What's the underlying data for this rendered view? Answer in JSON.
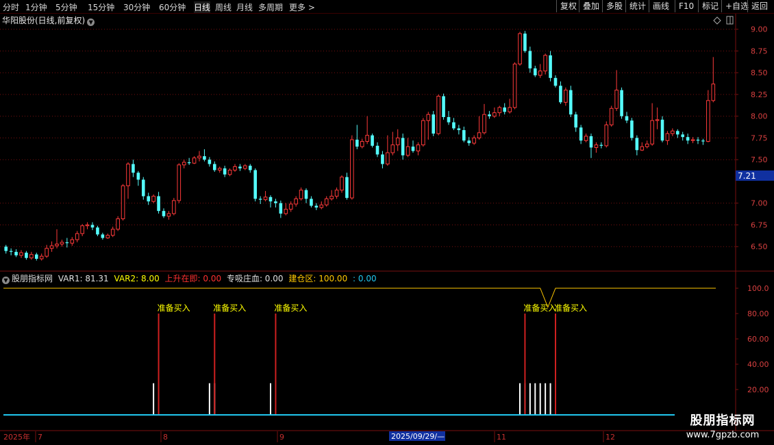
{
  "toolbar": {
    "periods": [
      "分时",
      "1分钟",
      "5分钟",
      "15分钟",
      "30分钟",
      "60分钟",
      "日线",
      "周线",
      "月线",
      "多周期",
      "更多 >"
    ],
    "active_period": "日线",
    "right_buttons": [
      "复权",
      "叠加",
      "多股",
      "统计",
      "画线",
      "F10",
      "标记",
      "+自选",
      "返回"
    ]
  },
  "stock_title": "华阳股份(日线,前复权)",
  "indicator": {
    "name": "股朋指标网",
    "var1": "VAR1: 81.31",
    "var2": "VAR2: 8.00",
    "rise": "上升在即: 0.00",
    "absorb": "专吸庄血: 0.00",
    "build": "建仓区: 100.00",
    "extra": ": 0.00"
  },
  "price_label": "7.21",
  "date_axis": {
    "year": "2025年",
    "months": [
      "7",
      "8",
      "9",
      "11",
      "12"
    ],
    "cursor_date": "2025/09/29/—"
  },
  "brand": {
    "name": "股朋指标网",
    "url": "www.7gpzb.com"
  },
  "colors": {
    "up": "#ff3a3a",
    "down": "#54fcfc",
    "ma_line": "#ffc800",
    "cyan_line": "#21c8f0",
    "grid": "#7a1010",
    "text_yellow": "#ffff00"
  },
  "chart_data": [
    {
      "type": "candlestick",
      "title": "华阳股份(日线,前复权)",
      "ylim": [
        6.25,
        9.1
      ],
      "yticks": [
        "9.00",
        "8.75",
        "8.50",
        "8.25",
        "8.00",
        "7.75",
        "7.50",
        "7.00",
        "6.75",
        "6.50"
      ],
      "ytick_values": [
        9.0,
        8.75,
        8.5,
        8.25,
        8.0,
        7.75,
        7.5,
        7.0,
        6.75,
        6.5
      ],
      "current_price": 7.21,
      "candles": [
        [
          6.5,
          6.45,
          6.52,
          6.42
        ],
        [
          6.45,
          6.44,
          6.48,
          6.4
        ],
        [
          6.44,
          6.4,
          6.47,
          6.38
        ],
        [
          6.4,
          6.43,
          6.46,
          6.37
        ],
        [
          6.43,
          6.37,
          6.45,
          6.35
        ],
        [
          6.37,
          6.41,
          6.44,
          6.35
        ],
        [
          6.41,
          6.36,
          6.43,
          6.34
        ],
        [
          6.36,
          6.39,
          6.42,
          6.34
        ],
        [
          6.39,
          6.48,
          6.52,
          6.37
        ],
        [
          6.48,
          6.51,
          6.56,
          6.44
        ],
        [
          6.51,
          6.53,
          6.7,
          6.48
        ],
        [
          6.53,
          6.55,
          6.58,
          6.5
        ],
        [
          6.55,
          6.54,
          6.6,
          6.49
        ],
        [
          6.54,
          6.58,
          6.61,
          6.51
        ],
        [
          6.58,
          6.65,
          6.68,
          6.55
        ],
        [
          6.65,
          6.74,
          6.76,
          6.62
        ],
        [
          6.74,
          6.75,
          6.78,
          6.7
        ],
        [
          6.75,
          6.72,
          6.78,
          6.69
        ],
        [
          6.72,
          6.64,
          6.74,
          6.62
        ],
        [
          6.64,
          6.6,
          6.66,
          6.58
        ],
        [
          6.6,
          6.63,
          6.65,
          6.59
        ],
        [
          6.63,
          6.7,
          6.73,
          6.61
        ],
        [
          6.7,
          6.82,
          6.85,
          6.68
        ],
        [
          6.82,
          7.2,
          7.22,
          6.8
        ],
        [
          7.2,
          7.45,
          7.47,
          7.05
        ],
        [
          7.45,
          7.35,
          7.5,
          7.3
        ],
        [
          7.35,
          7.27,
          7.37,
          7.2
        ],
        [
          7.27,
          7.08,
          7.3,
          7.04
        ],
        [
          7.08,
          7.02,
          7.12,
          6.98
        ],
        [
          7.02,
          7.08,
          7.1,
          7.0
        ],
        [
          7.08,
          6.91,
          7.13,
          6.88
        ],
        [
          6.91,
          6.85,
          6.94,
          6.83
        ],
        [
          6.85,
          6.88,
          6.91,
          6.81
        ],
        [
          6.88,
          7.03,
          7.06,
          6.86
        ],
        [
          7.03,
          7.44,
          7.46,
          7.0
        ],
        [
          7.44,
          7.47,
          7.5,
          7.4
        ],
        [
          7.47,
          7.46,
          7.52,
          7.44
        ],
        [
          7.46,
          7.52,
          7.54,
          7.45
        ],
        [
          7.52,
          7.54,
          7.6,
          7.48
        ],
        [
          7.54,
          7.5,
          7.62,
          7.48
        ],
        [
          7.5,
          7.45,
          7.53,
          7.42
        ],
        [
          7.45,
          7.38,
          7.48,
          7.36
        ],
        [
          7.38,
          7.4,
          7.42,
          7.35
        ],
        [
          7.4,
          7.33,
          7.43,
          7.3
        ],
        [
          7.33,
          7.38,
          7.4,
          7.31
        ],
        [
          7.38,
          7.42,
          7.45,
          7.36
        ],
        [
          7.42,
          7.4,
          7.45,
          7.37
        ],
        [
          7.4,
          7.43,
          7.45,
          7.38
        ],
        [
          7.43,
          7.38,
          7.45,
          7.35
        ],
        [
          7.38,
          7.05,
          7.4,
          7.02
        ],
        [
          7.05,
          7.04,
          7.08,
          6.99
        ],
        [
          7.04,
          7.07,
          7.14,
          7.02
        ],
        [
          7.07,
          7.02,
          7.09,
          6.95
        ],
        [
          7.02,
          7.0,
          7.05,
          6.95
        ],
        [
          7.0,
          6.88,
          7.03,
          6.83
        ],
        [
          6.88,
          6.93,
          7.0,
          6.86
        ],
        [
          6.93,
          6.99,
          7.02,
          6.9
        ],
        [
          6.99,
          7.05,
          7.08,
          6.96
        ],
        [
          7.05,
          7.15,
          7.18,
          7.03
        ],
        [
          7.15,
          7.05,
          7.17,
          7.0
        ],
        [
          7.05,
          6.97,
          7.08,
          6.95
        ],
        [
          6.97,
          6.95,
          7.0,
          6.92
        ],
        [
          6.95,
          6.98,
          7.02,
          6.93
        ],
        [
          6.98,
          7.05,
          7.08,
          6.96
        ],
        [
          7.05,
          7.08,
          7.15,
          7.03
        ],
        [
          7.08,
          7.15,
          7.18,
          7.05
        ],
        [
          7.15,
          7.3,
          7.32,
          7.12
        ],
        [
          7.3,
          7.06,
          7.35,
          7.04
        ],
        [
          7.06,
          7.73,
          7.78,
          7.04
        ],
        [
          7.73,
          7.65,
          7.9,
          7.62
        ],
        [
          7.65,
          7.71,
          7.74,
          7.63
        ],
        [
          7.71,
          7.78,
          8.0,
          7.68
        ],
        [
          7.78,
          7.66,
          7.8,
          7.64
        ],
        [
          7.66,
          7.56,
          7.7,
          7.53
        ],
        [
          7.56,
          7.45,
          7.6,
          7.4
        ],
        [
          7.45,
          7.58,
          7.78,
          7.43
        ],
        [
          7.58,
          7.67,
          7.82,
          7.55
        ],
        [
          7.67,
          7.75,
          7.85,
          7.6
        ],
        [
          7.75,
          7.55,
          7.8,
          7.5
        ],
        [
          7.55,
          7.65,
          7.75,
          7.53
        ],
        [
          7.65,
          7.6,
          7.72,
          7.58
        ],
        [
          7.6,
          7.67,
          7.7,
          7.55
        ],
        [
          7.67,
          7.95,
          7.98,
          7.65
        ],
        [
          7.95,
          8.02,
          8.05,
          7.73
        ],
        [
          8.02,
          7.8,
          8.06,
          7.77
        ],
        [
          7.8,
          8.23,
          8.25,
          7.78
        ],
        [
          8.23,
          7.99,
          8.26,
          7.96
        ],
        [
          7.99,
          7.93,
          8.06,
          7.9
        ],
        [
          7.93,
          7.86,
          7.98,
          7.84
        ],
        [
          7.86,
          7.84,
          7.9,
          7.79
        ],
        [
          7.84,
          7.72,
          7.88,
          7.7
        ],
        [
          7.72,
          7.69,
          7.76,
          7.66
        ],
        [
          7.69,
          7.75,
          7.78,
          7.67
        ],
        [
          7.75,
          7.81,
          8.0,
          7.73
        ],
        [
          7.81,
          8.02,
          8.14,
          7.79
        ],
        [
          8.02,
          8.0,
          8.06,
          7.97
        ],
        [
          8.0,
          8.04,
          8.1,
          7.98
        ],
        [
          8.04,
          8.1,
          8.12,
          8.0
        ],
        [
          8.1,
          8.05,
          8.15,
          8.02
        ],
        [
          8.05,
          8.1,
          8.2,
          8.03
        ],
        [
          8.1,
          8.6,
          8.62,
          8.08
        ],
        [
          8.6,
          8.95,
          8.97,
          8.58
        ],
        [
          8.95,
          8.75,
          8.98,
          8.73
        ],
        [
          8.75,
          8.55,
          8.8,
          8.5
        ],
        [
          8.55,
          8.47,
          8.58,
          8.45
        ],
        [
          8.47,
          8.52,
          8.6,
          8.44
        ],
        [
          8.52,
          8.7,
          8.72,
          8.48
        ],
        [
          8.7,
          8.44,
          8.75,
          8.4
        ],
        [
          8.44,
          8.35,
          8.47,
          8.33
        ],
        [
          8.35,
          8.16,
          8.4,
          8.14
        ],
        [
          8.16,
          8.3,
          8.33,
          8.12
        ],
        [
          8.3,
          8.02,
          8.35,
          7.99
        ],
        [
          8.02,
          7.87,
          8.05,
          7.82
        ],
        [
          7.87,
          7.72,
          7.9,
          7.68
        ],
        [
          7.72,
          7.77,
          7.8,
          7.7
        ],
        [
          7.77,
          7.64,
          7.8,
          7.52
        ],
        [
          7.64,
          7.67,
          7.7,
          7.58
        ],
        [
          7.67,
          7.66,
          7.7,
          7.63
        ],
        [
          7.66,
          7.9,
          7.94,
          7.64
        ],
        [
          7.9,
          8.09,
          8.12,
          7.88
        ],
        [
          8.09,
          8.3,
          8.53,
          8.06
        ],
        [
          8.3,
          8.0,
          8.33,
          7.97
        ],
        [
          8.0,
          7.95,
          8.05,
          7.92
        ],
        [
          7.95,
          7.75,
          7.98,
          7.72
        ],
        [
          7.75,
          7.61,
          7.78,
          7.55
        ],
        [
          7.61,
          7.65,
          7.7,
          7.6
        ],
        [
          7.65,
          7.68,
          7.72,
          7.63
        ],
        [
          7.68,
          7.95,
          8.15,
          7.66
        ],
        [
          7.95,
          7.96,
          8.1,
          7.85
        ],
        [
          7.96,
          7.72,
          8.0,
          7.7
        ],
        [
          7.72,
          7.8,
          7.83,
          7.67
        ],
        [
          7.8,
          7.83,
          7.86,
          7.77
        ],
        [
          7.83,
          7.79,
          7.85,
          7.75
        ],
        [
          7.79,
          7.76,
          7.82,
          7.72
        ],
        [
          7.76,
          7.72,
          7.8,
          7.68
        ],
        [
          7.72,
          7.73,
          7.76,
          7.69
        ],
        [
          7.73,
          7.72,
          7.76,
          7.68
        ],
        [
          7.72,
          7.71,
          7.74,
          7.67
        ],
        [
          7.71,
          8.18,
          8.3,
          7.7
        ],
        [
          8.18,
          8.37,
          8.68,
          8.16
        ]
      ]
    },
    {
      "type": "indicator",
      "title": "股朋指标网",
      "ylim": [
        0,
        110
      ],
      "yticks": [
        "100.0",
        "80.00",
        "60.00",
        "40.00",
        "20.00"
      ],
      "ytick_values": [
        100,
        80,
        60,
        40,
        20
      ],
      "buy_label": "准备买入",
      "buy_signals": [
        30,
        41,
        53,
        102,
        108
      ],
      "white_bars": [
        29,
        40,
        41,
        52,
        101,
        102,
        103,
        104,
        105,
        106,
        107
      ],
      "yellow_line": {
        "value": 100,
        "dip": {
          "from": 105,
          "to": 108,
          "low": 85
        }
      },
      "cyan_line": 0
    }
  ]
}
